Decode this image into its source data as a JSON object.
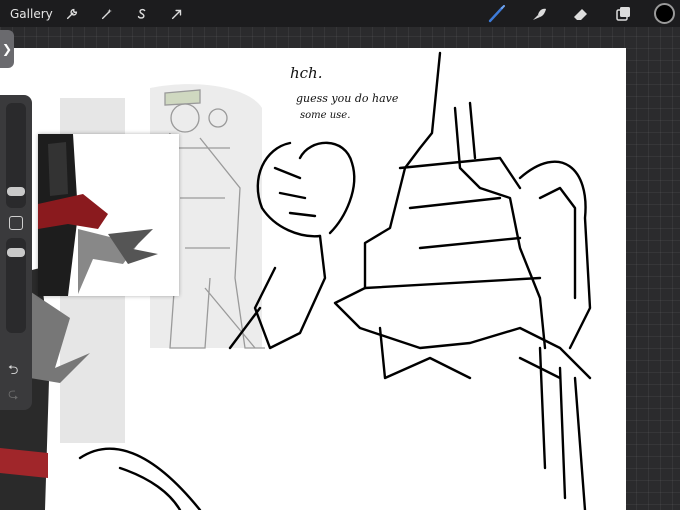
{
  "toolbar": {
    "gallery_label": "Gallery",
    "left_icons": [
      "wrench-icon",
      "magic-wand-icon",
      "selection-s-icon",
      "transform-arrow-icon"
    ],
    "right_icons": [
      "brush-icon",
      "smudge-icon",
      "eraser-icon",
      "layers-icon"
    ],
    "active_tool": "brush",
    "active_tool_color": "#3d7bd9",
    "current_color": "#000000"
  },
  "canvas": {
    "notes": {
      "line1": "hch.",
      "line2": "guess you do have",
      "line3": "some use."
    }
  },
  "sidebar": {
    "expand_icon": "chevron-right-icon",
    "undo_icon": "undo-icon",
    "redo_icon": "redo-icon"
  }
}
